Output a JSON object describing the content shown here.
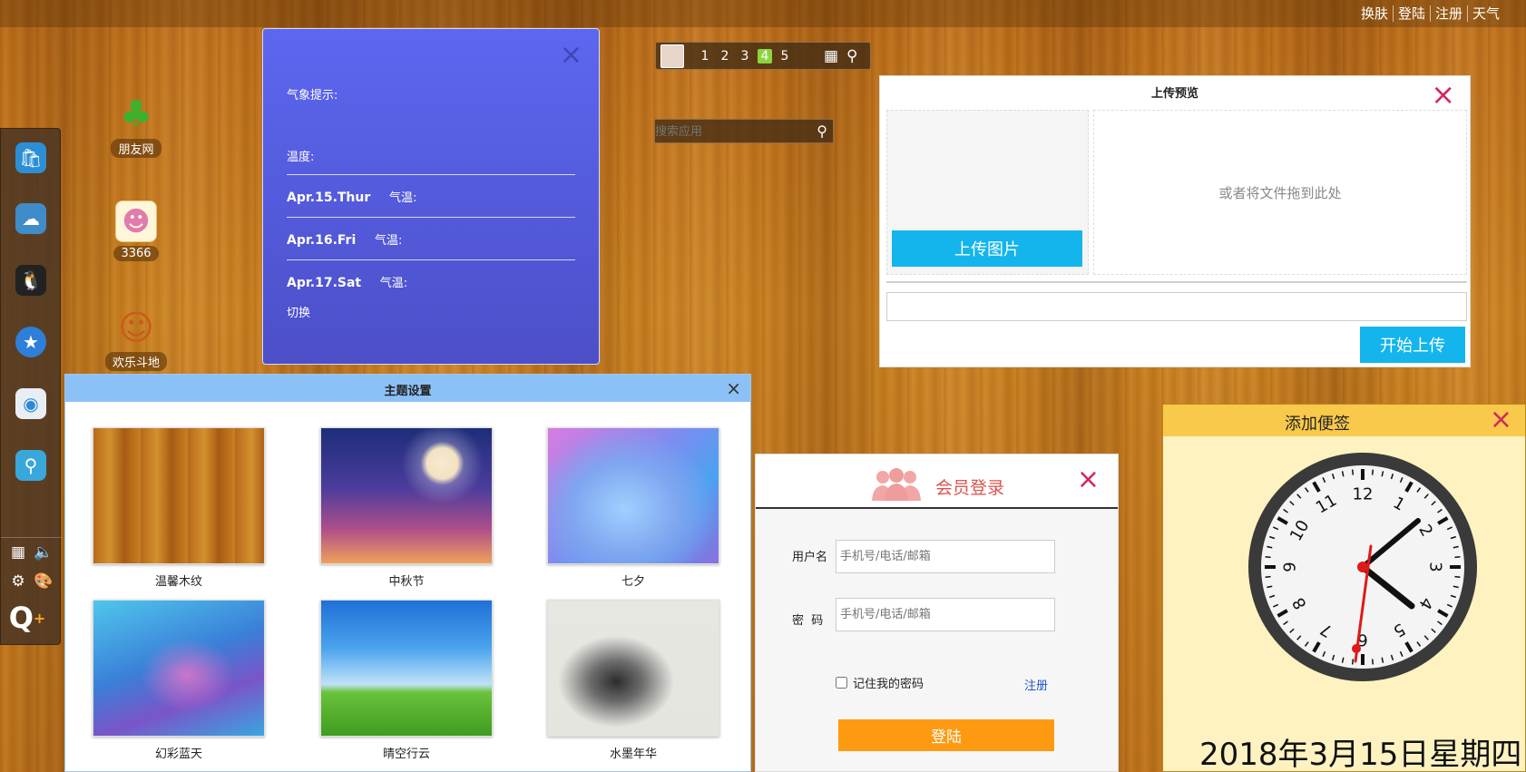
{
  "topbar": {
    "menu": [
      "换肤",
      "登陆",
      "注册",
      "天气"
    ]
  },
  "desktop_icons": [
    {
      "label": "朋友网",
      "icon": "clover-icon"
    },
    {
      "label": "3366",
      "icon": "game-3366-icon"
    },
    {
      "label": "欢乐斗地",
      "icon": "doudizhu-icon"
    }
  ],
  "dock": {
    "apps": [
      "shopping-bag-icon",
      "cloud-drive-icon",
      "qq-penguin-icon",
      "star-game-icon",
      "browser-icon",
      "search-app-icon"
    ],
    "tools": [
      "layout-icon",
      "volume-icon",
      "settings-icon",
      "palette-icon",
      "qq-logo-icon"
    ]
  },
  "weather": {
    "hint_label": "气象提示:",
    "temp_label": "温度:",
    "days": [
      {
        "date": "Apr.15.Thur",
        "temp_label": "气温:"
      },
      {
        "date": "Apr.16.Fri",
        "temp_label": "气温:"
      },
      {
        "date": "Apr.17.Sat",
        "temp_label": "气温:"
      }
    ],
    "switch_label": "切换",
    "close": "×"
  },
  "pagebar": {
    "pages": [
      "1",
      "2",
      "3",
      "4",
      "5"
    ],
    "active": "4"
  },
  "search": {
    "placeholder": "搜索应用"
  },
  "upload": {
    "title": "上传预览",
    "drop_hint": "或者将文件拖到此处",
    "upload_button": "上传图片",
    "start_button": "开始上传",
    "close": "×"
  },
  "theme": {
    "title": "主题设置",
    "close": "×",
    "items": [
      {
        "name": "温馨木纹"
      },
      {
        "name": "中秋节"
      },
      {
        "name": "七夕"
      },
      {
        "name": "幻彩蓝天"
      },
      {
        "name": "晴空行云"
      },
      {
        "name": "水墨年华"
      }
    ]
  },
  "login": {
    "title": "会员登录",
    "username_label": "用户名",
    "username_placeholder": "手机号/电话/邮箱",
    "password_label": "密  码",
    "password_placeholder": "手机号/电话/邮箱",
    "remember_label": "记住我的密码",
    "register_link": "注册",
    "submit": "登陆",
    "close": "×"
  },
  "note": {
    "title": "添加便签",
    "close": "×",
    "date": "2018年3月15日星期四",
    "clock_numbers": [
      "12",
      "1",
      "2",
      "3",
      "4",
      "5",
      "6",
      "7",
      "8",
      "9",
      "10",
      "11"
    ]
  },
  "colors": {
    "accent_blue": "#13b5ec",
    "close_red": "#d2285c",
    "login_orange": "#fe9a12",
    "note_yellow": "#f8c94a",
    "weather_purple": "#5560e6"
  }
}
